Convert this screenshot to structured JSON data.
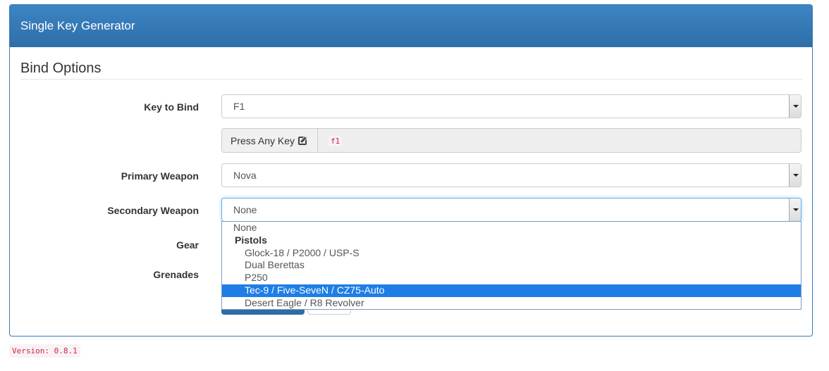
{
  "panel": {
    "title": "Single Key Generator"
  },
  "form": {
    "legend": "Bind Options",
    "key_to_bind": {
      "label": "Key to Bind",
      "value": "F1"
    },
    "press_key": {
      "button_label": "Press Any Key",
      "captured_code": "f1"
    },
    "primary_weapon": {
      "label": "Primary Weapon",
      "value": "Nova"
    },
    "secondary_weapon": {
      "label": "Secondary Weapon",
      "value": "None",
      "options": [
        {
          "label": "None",
          "kind": "option"
        },
        {
          "label": "Pistols",
          "kind": "group"
        },
        {
          "label": "Glock-18 / P2000 / USP-S",
          "kind": "child"
        },
        {
          "label": "Dual Berettas",
          "kind": "child"
        },
        {
          "label": "P250",
          "kind": "child"
        },
        {
          "label": "Tec-9 / Five-SeveN / CZ75-Auto",
          "kind": "child",
          "highlighted": true
        },
        {
          "label": "Desert Eagle / R8 Revolver",
          "kind": "child"
        }
      ]
    },
    "gear": {
      "label": "Gear"
    },
    "grenades": {
      "label": "Grenades"
    }
  },
  "footer": {
    "version": "Version: 0.8.1"
  },
  "colors": {
    "header": "#337ab7",
    "highlight": "#1e7ee6",
    "code_text": "#c7254e"
  }
}
